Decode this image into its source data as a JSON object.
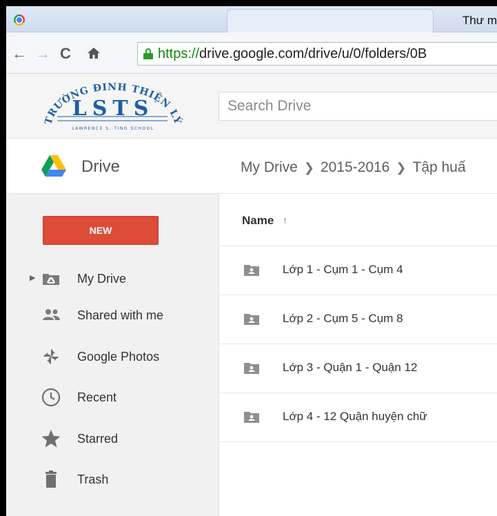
{
  "window": {
    "title": "Thư m"
  },
  "browser": {
    "url_scheme": "https://",
    "url_rest": "drive.google.com/drive/u/0/folders/0B"
  },
  "logo": {
    "top_text": "TRƯỜNG ĐINH THIỆN LÝ",
    "main_text": "LSTS",
    "bottom_text": "LAWRENCE S. TING SCHOOL"
  },
  "search": {
    "placeholder": "Search Drive"
  },
  "app": {
    "name": "Drive"
  },
  "breadcrumb": [
    "My Drive",
    "2015-2016",
    "Tập huấ"
  ],
  "sidebar": {
    "new_label": "NEW",
    "items": [
      {
        "label": "My Drive",
        "icon": "my-drive-icon"
      },
      {
        "label": "Shared with me",
        "icon": "shared-icon"
      },
      {
        "label": "Google Photos",
        "icon": "photos-icon"
      },
      {
        "label": "Recent",
        "icon": "clock-icon"
      },
      {
        "label": "Starred",
        "icon": "star-icon"
      },
      {
        "label": "Trash",
        "icon": "trash-icon"
      }
    ]
  },
  "list": {
    "column_name": "Name",
    "sort_arrow": "↑",
    "rows": [
      {
        "name": "Lớp 1 - Cụm 1 - Cụm 4"
      },
      {
        "name": "Lớp 2 - Cụm 5 - Cụm 8"
      },
      {
        "name": "Lớp 3 - Quận 1 - Quận 12"
      },
      {
        "name": "Lớp 4 - 12 Quận huyện chữ"
      }
    ]
  },
  "colors": {
    "new_button": "#dd4b39",
    "lock_green": "#2a9a2a",
    "logo_blue": "#1d5fa3",
    "folder_gray": "#8f8f8f"
  }
}
